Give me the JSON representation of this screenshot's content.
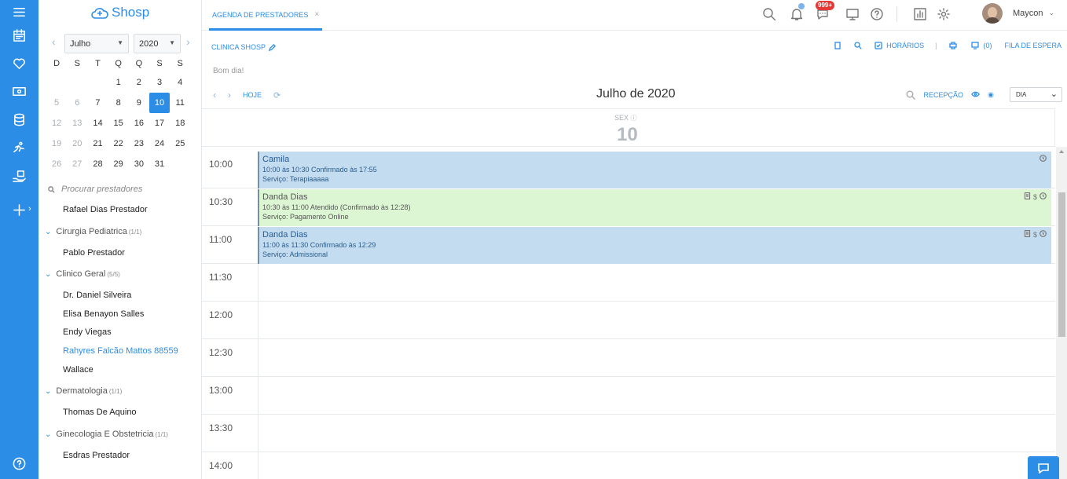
{
  "brand": {
    "name": "Shosp"
  },
  "topbar": {
    "tab_label": "AGENDA DE PRESTADORES",
    "tab_close": "×",
    "messages_badge": "999+",
    "user_name": "Maycon",
    "user_caret": "⌄"
  },
  "mini_calendar": {
    "month": "Julho",
    "year": "2020",
    "weekdays": [
      "D",
      "S",
      "T",
      "Q",
      "Q",
      "S",
      "S"
    ],
    "days": [
      {
        "d": "",
        "muted": false
      },
      {
        "d": "",
        "muted": false
      },
      {
        "d": "",
        "muted": false
      },
      {
        "d": "1",
        "muted": false
      },
      {
        "d": "2",
        "muted": false
      },
      {
        "d": "3",
        "muted": false
      },
      {
        "d": "4",
        "muted": false
      },
      {
        "d": "5",
        "muted": true
      },
      {
        "d": "6",
        "muted": true
      },
      {
        "d": "7",
        "muted": false
      },
      {
        "d": "8",
        "muted": false
      },
      {
        "d": "9",
        "muted": false
      },
      {
        "d": "10",
        "today": true
      },
      {
        "d": "11",
        "muted": false
      },
      {
        "d": "12",
        "muted": true
      },
      {
        "d": "13",
        "muted": true
      },
      {
        "d": "14",
        "muted": false
      },
      {
        "d": "15",
        "muted": false
      },
      {
        "d": "16",
        "muted": false
      },
      {
        "d": "17",
        "muted": false
      },
      {
        "d": "18",
        "muted": false
      },
      {
        "d": "19",
        "muted": true
      },
      {
        "d": "20",
        "muted": true
      },
      {
        "d": "21",
        "muted": false
      },
      {
        "d": "22",
        "muted": false
      },
      {
        "d": "23",
        "muted": false
      },
      {
        "d": "24",
        "muted": false
      },
      {
        "d": "25",
        "muted": false
      },
      {
        "d": "26",
        "muted": true
      },
      {
        "d": "27",
        "muted": true
      },
      {
        "d": "28",
        "muted": false
      },
      {
        "d": "29",
        "muted": false
      },
      {
        "d": "30",
        "muted": false
      },
      {
        "d": "31",
        "muted": false
      }
    ]
  },
  "providers": {
    "search_placeholder": "Procurar prestadores",
    "items": [
      {
        "type": "item",
        "label": "Rafael Dias Prestador"
      },
      {
        "type": "group",
        "label": "Cirurgia Pediatrica",
        "count": "(1/1)"
      },
      {
        "type": "item",
        "label": "Pablo Prestador"
      },
      {
        "type": "group",
        "label": "Clinico Geral",
        "count": "(5/5)"
      },
      {
        "type": "item",
        "label": "Dr. Daniel Silveira"
      },
      {
        "type": "item",
        "label": "Elisa Benayon Salles"
      },
      {
        "type": "item",
        "label": "Endy Viegas"
      },
      {
        "type": "item",
        "label": "Rahyres Falcão Mattos 88559",
        "active": true
      },
      {
        "type": "item",
        "label": "Wallace"
      },
      {
        "type": "group",
        "label": "Dermatologia",
        "count": "(1/1)"
      },
      {
        "type": "item",
        "label": "Thomas De Aquino"
      },
      {
        "type": "group",
        "label": "Ginecologia E Obstetricia",
        "count": "(1/1)"
      },
      {
        "type": "item",
        "label": "Esdras Prestador"
      }
    ]
  },
  "header": {
    "clinic": "CLINICA SHOSP",
    "horarios": "HORÁRIOS",
    "queue_count": "(0)",
    "queue_label": "FILA DE ESPERA",
    "greeting": "Bom dia!"
  },
  "calendar": {
    "today_label": "HOJE",
    "title": "Julho de 2020",
    "reception": "RECEPÇÃO",
    "view": "DIA",
    "day_name": "SEX",
    "day_number": "10",
    "slots": [
      "10:00",
      "10:30",
      "11:00",
      "11:30",
      "12:00",
      "12:30",
      "13:00",
      "13:30",
      "14:00"
    ],
    "appointments": [
      {
        "slot": 0,
        "color": "blue",
        "name": "Camila",
        "line1": "10:00 às 10:30 Confirmado às 17:55",
        "line2": "Serviço: Terapiaaaaa",
        "dollar": ""
      },
      {
        "slot": 1,
        "color": "green",
        "name": "Danda Dias",
        "line1": "10:30 às 11:00 Atendido (Confirmado às 12:28)",
        "line2": "Serviço: Pagamento Online",
        "dollar": "$"
      },
      {
        "slot": 2,
        "color": "blue",
        "name": "Danda Dias",
        "line1": "11:00 às 11:30 Confirmado às 12:29",
        "line2": "Serviço: Admissional",
        "dollar": "$"
      }
    ]
  }
}
